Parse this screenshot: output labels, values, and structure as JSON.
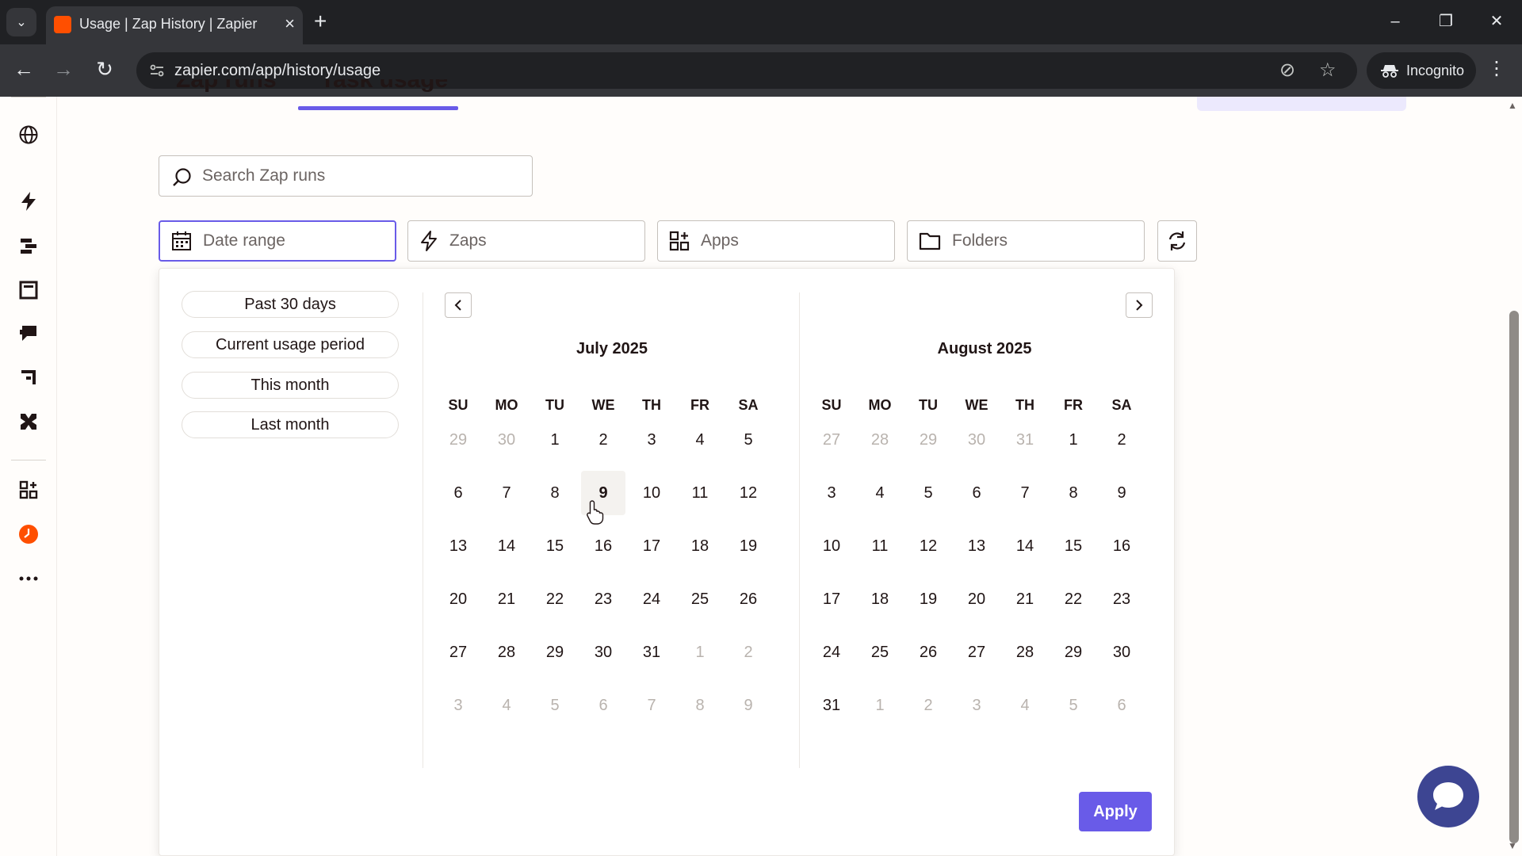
{
  "browser": {
    "tab_title": "Usage | Zap History | Zapier",
    "url": "zapier.com/app/history/usage",
    "incognito_label": "Incognito"
  },
  "page": {
    "tabs": [
      {
        "label": "Zap runs"
      },
      {
        "label": "Task usage"
      }
    ],
    "search": {
      "placeholder": "Search Zap runs",
      "value": ""
    },
    "filters": {
      "date_range": "Date range",
      "zaps": "Zaps",
      "apps": "Apps",
      "folders": "Folders"
    }
  },
  "picker": {
    "presets": [
      "Past 30 days",
      "Current usage period",
      "This month",
      "Last month"
    ],
    "weekdays": [
      "SU",
      "MO",
      "TU",
      "WE",
      "TH",
      "FR",
      "SA"
    ],
    "months": [
      {
        "title": "July 2025",
        "weeks": [
          [
            {
              "d": "29",
              "m": 1
            },
            {
              "d": "30",
              "m": 1
            },
            {
              "d": "1"
            },
            {
              "d": "2"
            },
            {
              "d": "3"
            },
            {
              "d": "4"
            },
            {
              "d": "5"
            }
          ],
          [
            {
              "d": "6"
            },
            {
              "d": "7"
            },
            {
              "d": "8"
            },
            {
              "d": "9",
              "h": 1
            },
            {
              "d": "10"
            },
            {
              "d": "11"
            },
            {
              "d": "12"
            }
          ],
          [
            {
              "d": "13"
            },
            {
              "d": "14"
            },
            {
              "d": "15"
            },
            {
              "d": "16"
            },
            {
              "d": "17"
            },
            {
              "d": "18"
            },
            {
              "d": "19"
            }
          ],
          [
            {
              "d": "20"
            },
            {
              "d": "21"
            },
            {
              "d": "22"
            },
            {
              "d": "23"
            },
            {
              "d": "24"
            },
            {
              "d": "25"
            },
            {
              "d": "26"
            }
          ],
          [
            {
              "d": "27"
            },
            {
              "d": "28"
            },
            {
              "d": "29"
            },
            {
              "d": "30"
            },
            {
              "d": "31"
            },
            {
              "d": "1",
              "m": 1
            },
            {
              "d": "2",
              "m": 1
            }
          ],
          [
            {
              "d": "3",
              "m": 1
            },
            {
              "d": "4",
              "m": 1
            },
            {
              "d": "5",
              "m": 1
            },
            {
              "d": "6",
              "m": 1
            },
            {
              "d": "7",
              "m": 1
            },
            {
              "d": "8",
              "m": 1
            },
            {
              "d": "9",
              "m": 1
            }
          ]
        ]
      },
      {
        "title": "August 2025",
        "weeks": [
          [
            {
              "d": "27",
              "m": 1
            },
            {
              "d": "28",
              "m": 1
            },
            {
              "d": "29",
              "m": 1
            },
            {
              "d": "30",
              "m": 1
            },
            {
              "d": "31",
              "m": 1
            },
            {
              "d": "1"
            },
            {
              "d": "2"
            }
          ],
          [
            {
              "d": "3"
            },
            {
              "d": "4"
            },
            {
              "d": "5"
            },
            {
              "d": "6"
            },
            {
              "d": "7"
            },
            {
              "d": "8"
            },
            {
              "d": "9"
            }
          ],
          [
            {
              "d": "10"
            },
            {
              "d": "11"
            },
            {
              "d": "12"
            },
            {
              "d": "13"
            },
            {
              "d": "14"
            },
            {
              "d": "15"
            },
            {
              "d": "16"
            }
          ],
          [
            {
              "d": "17"
            },
            {
              "d": "18"
            },
            {
              "d": "19"
            },
            {
              "d": "20"
            },
            {
              "d": "21"
            },
            {
              "d": "22"
            },
            {
              "d": "23"
            }
          ],
          [
            {
              "d": "24"
            },
            {
              "d": "25"
            },
            {
              "d": "26"
            },
            {
              "d": "27"
            },
            {
              "d": "28"
            },
            {
              "d": "29"
            },
            {
              "d": "30"
            }
          ],
          [
            {
              "d": "31"
            },
            {
              "d": "1",
              "m": 1
            },
            {
              "d": "2",
              "m": 1
            },
            {
              "d": "3",
              "m": 1
            },
            {
              "d": "4",
              "m": 1
            },
            {
              "d": "5",
              "m": 1
            },
            {
              "d": "6",
              "m": 1
            }
          ]
        ]
      }
    ],
    "apply_label": "Apply"
  },
  "colors": {
    "accent": "#695be8",
    "brand_orange": "#ff4f00",
    "chat_bubble": "#3d4592"
  },
  "icons": {
    "left_nav": [
      "globe-icon",
      "zap-icon",
      "tables-icon",
      "interfaces-icon",
      "chatbots-icon",
      "canvas-icon",
      "agents-icon",
      "apps-icon",
      "history-icon",
      "more-icon"
    ]
  }
}
